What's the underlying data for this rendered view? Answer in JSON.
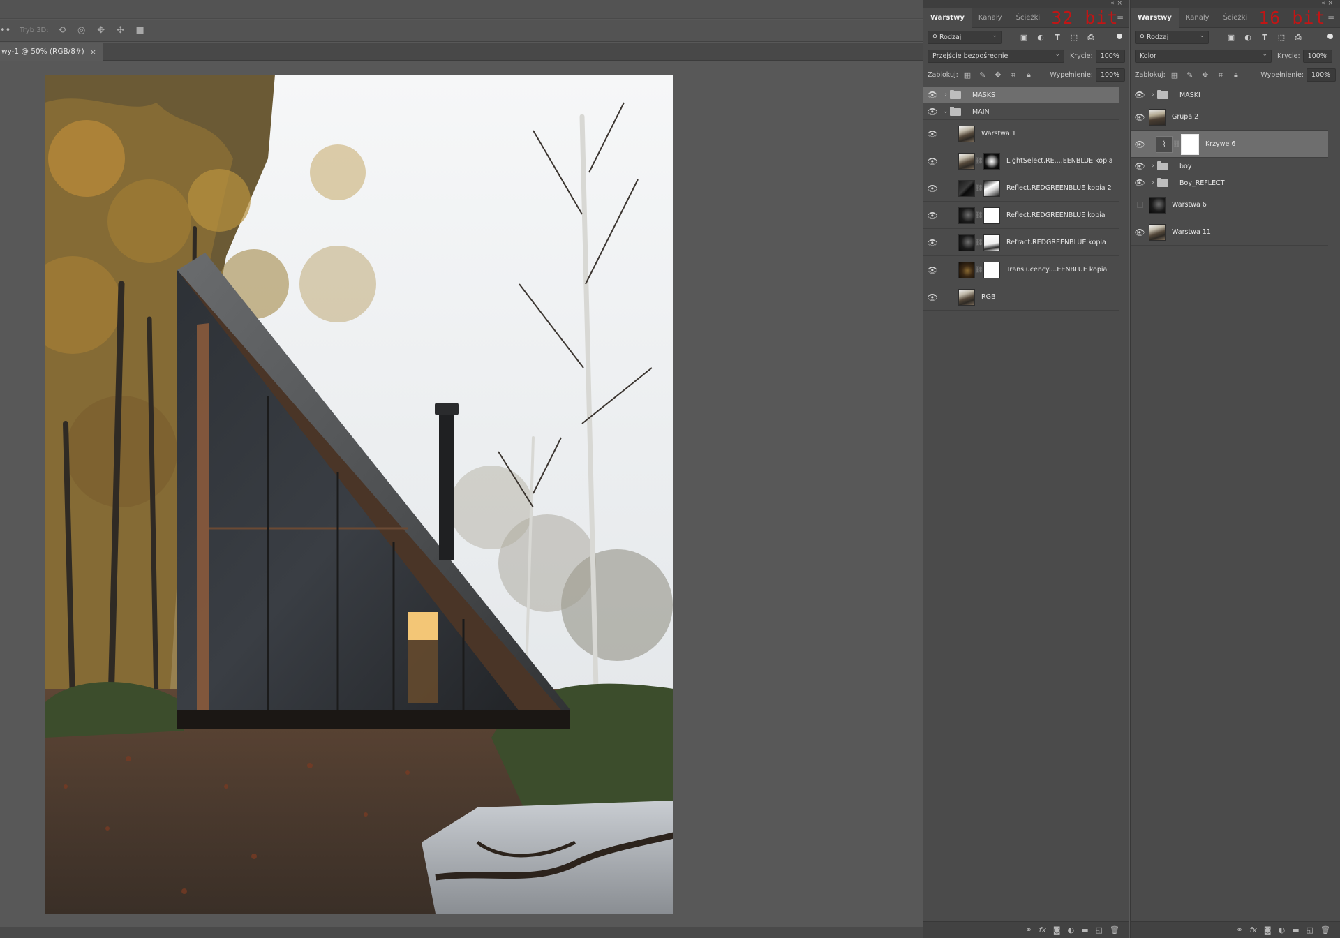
{
  "workspace": {
    "options_bar": {
      "menu_dots": "••",
      "mode_3d_label": "Tryb 3D:",
      "icons_3d": [
        "rotate-3d-icon",
        "roll-3d-icon",
        "pan-3d-icon",
        "slide-3d-icon",
        "camera-3d-icon"
      ]
    },
    "doc_tab": {
      "title": "wy-1 @ 50% (RGB/8#)",
      "close": "×"
    }
  },
  "panel_left": {
    "tabs": [
      "Warstwy",
      "Kanały",
      "Ścieżki"
    ],
    "bit_label": "32 bit",
    "filter_dropdown": "Rodzaj",
    "blend_mode": "Przejście bezpośrednie",
    "opacity_label": "Krycie:",
    "opacity_value": "100%",
    "lock_label": "Zablokuj:",
    "fill_label": "Wypełnienie:",
    "fill_value": "100%",
    "layers": [
      {
        "name": "MASKS",
        "type": "group",
        "expanded": false,
        "selected": true
      },
      {
        "name": "MAIN",
        "type": "group",
        "expanded": true
      },
      {
        "name": "Warstwa 1",
        "type": "pixel",
        "thumb": "photo"
      },
      {
        "name": "LightSelect.RE....EENBLUE kopia",
        "type": "masked",
        "thumb": "photo",
        "mask": "mask"
      },
      {
        "name": "Reflect.REDGREENBLUE kopia 2",
        "type": "masked",
        "thumb": "dark2",
        "mask": "mask2"
      },
      {
        "name": "Reflect.REDGREENBLUE kopia",
        "type": "masked",
        "thumb": "dark",
        "mask": "white"
      },
      {
        "name": "Refract.REDGREENBLUE kopia",
        "type": "masked",
        "thumb": "dark",
        "mask": "mask3"
      },
      {
        "name": "Translucency....EENBLUE kopia",
        "type": "masked",
        "thumb": "brown",
        "mask": "white"
      },
      {
        "name": "RGB",
        "type": "pixel",
        "thumb": "photo"
      }
    ]
  },
  "panel_right": {
    "tabs": [
      "Warstwy",
      "Kanały",
      "Ścieżki"
    ],
    "bit_label": "16 bit",
    "filter_dropdown": "Rodzaj",
    "blend_mode": "Kolor",
    "opacity_label": "Krycie:",
    "opacity_value": "100%",
    "lock_label": "Zablokuj:",
    "fill_label": "Wypełnienie:",
    "fill_value": "100%",
    "layers": [
      {
        "name": "MASKI",
        "type": "group",
        "expanded": false
      },
      {
        "name": "Grupa 2",
        "type": "pixel",
        "thumb": "group"
      },
      {
        "name": "Krzywe 6",
        "type": "adjustment",
        "selected": true
      },
      {
        "name": "boy",
        "type": "group",
        "expanded": false
      },
      {
        "name": "Boy_REFLECT",
        "type": "group",
        "expanded": false
      },
      {
        "name": "Warstwa 6",
        "type": "pixel",
        "thumb": "dark",
        "hidden": true
      },
      {
        "name": "Warstwa 11",
        "type": "pixel",
        "thumb": "photo"
      }
    ]
  },
  "footer_icons": [
    "link-layers-icon",
    "fx-icon",
    "add-mask-icon",
    "adjustment-layer-icon",
    "new-group-icon",
    "new-layer-icon",
    "delete-layer-icon"
  ],
  "colors": {
    "bit_label": "#c21515",
    "panel_bg": "#4b4b4b",
    "workspace_bg": "#585858"
  }
}
